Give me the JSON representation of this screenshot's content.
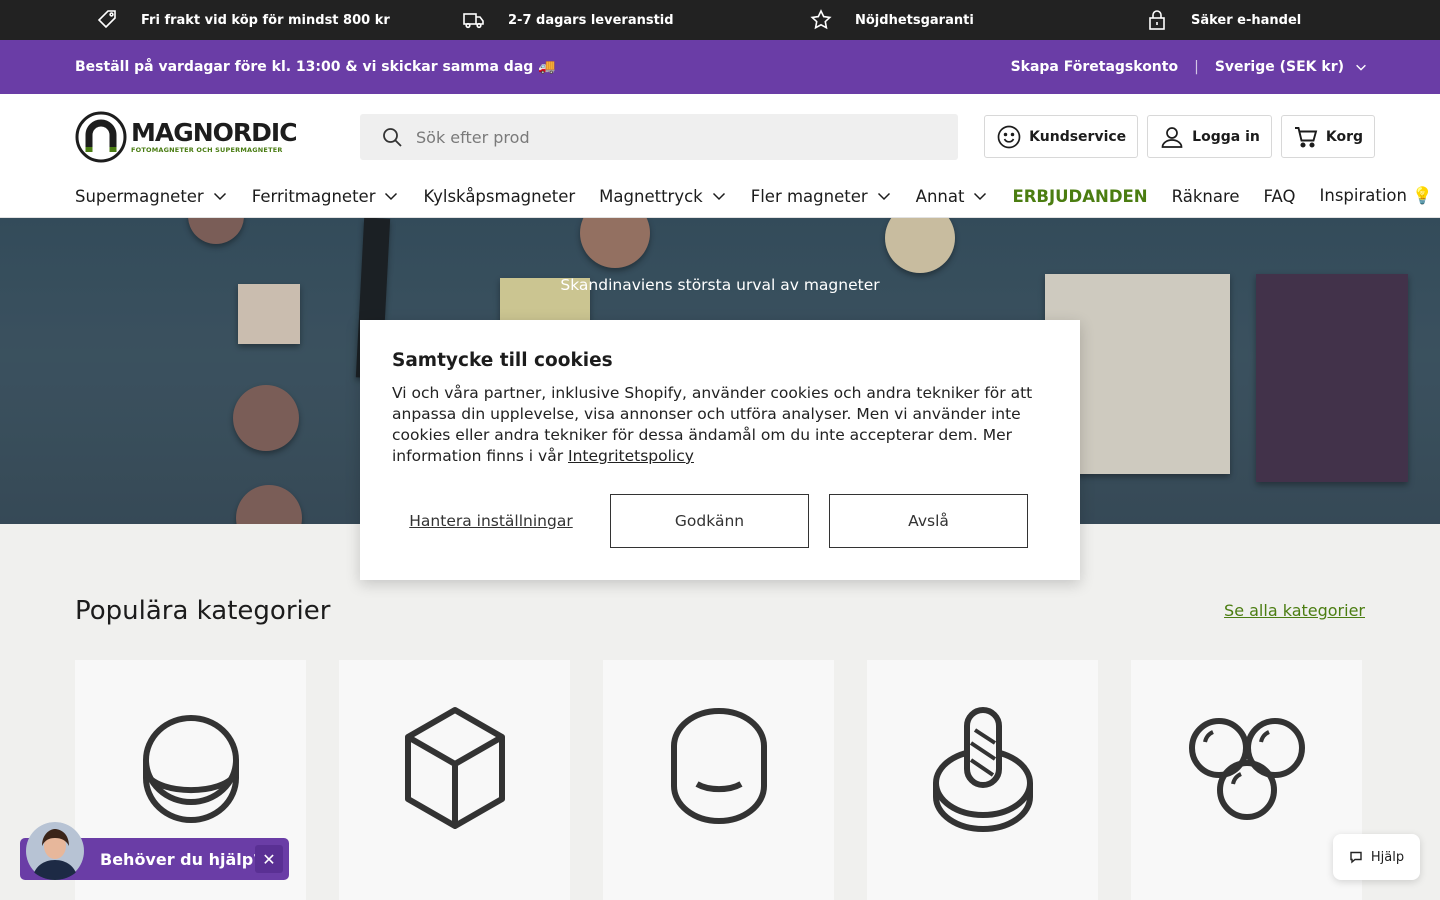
{
  "usp_bar": {
    "items": [
      {
        "icon": "tag-icon",
        "text": "Fri frakt vid köp för mindst 800 kr"
      },
      {
        "icon": "truck-icon",
        "text": "2-7 dagars leveranstid"
      },
      {
        "icon": "star-icon",
        "text": "Nöjdhetsgaranti"
      },
      {
        "icon": "lock-icon",
        "text": "Säker e-handel"
      }
    ]
  },
  "promo_bar": {
    "text": "Beställ på vardagar före kl. 13:00 & vi skickar samma dag 🚚",
    "business_account": "Skapa Företagskonto",
    "separator": "|",
    "country": "Sverige (SEK kr)"
  },
  "header": {
    "logo_name": "MAGNORDIC",
    "logo_tagline": "FOTOMAGNETER OCH SUPERMAGNETER",
    "search_placeholder": "Sök efter prod",
    "buttons": {
      "customer_service": "Kundservice",
      "login": "Logga in",
      "cart": "Korg"
    }
  },
  "nav": {
    "items": [
      {
        "label": "Supermagneter",
        "dropdown": true
      },
      {
        "label": "Ferritmagneter",
        "dropdown": true
      },
      {
        "label": "Kylskåpsmagneter",
        "dropdown": false
      },
      {
        "label": "Magnettryck",
        "dropdown": true
      },
      {
        "label": "Fler magneter",
        "dropdown": true
      },
      {
        "label": "Annat",
        "dropdown": true
      },
      {
        "label": "ERBJUDANDEN",
        "dropdown": false,
        "highlight": true
      },
      {
        "label": "Räknare",
        "dropdown": false
      },
      {
        "label": "FAQ",
        "dropdown": false
      },
      {
        "label": "Inspiration 💡",
        "dropdown": false
      }
    ]
  },
  "hero": {
    "title": "Skandinaviens största urval av magneter"
  },
  "categories": {
    "title": "Populära kategorier",
    "see_all": "Se alla kategorier",
    "cards": [
      {
        "icon": "disc-magnet-icon"
      },
      {
        "icon": "block-magnet-icon"
      },
      {
        "icon": "pot-magnet-icon"
      },
      {
        "icon": "hook-magnet-icon"
      },
      {
        "icon": "sphere-magnets-icon"
      }
    ]
  },
  "cookie_modal": {
    "title": "Samtycke till cookies",
    "body": "Vi och våra partner, inklusive Shopify, använder cookies och andra tekniker för att anpassa din upplevelse, visa annonser och utföra analyser. Men vi använder inte cookies eller andra tekniker för dessa ändamål om du inte accepterar dem. Mer information finns i vår ",
    "policy_link": "Integritetspolicy",
    "manage": "Hantera inställningar",
    "accept": "Godkänn",
    "decline": "Avslå"
  },
  "chat": {
    "text": "Behöver du hjälp?",
    "close": "✕"
  },
  "help_button": {
    "label": "Hjälp"
  },
  "colors": {
    "purple": "#6a3da6",
    "dark": "#222222",
    "green": "#4b7d11"
  }
}
